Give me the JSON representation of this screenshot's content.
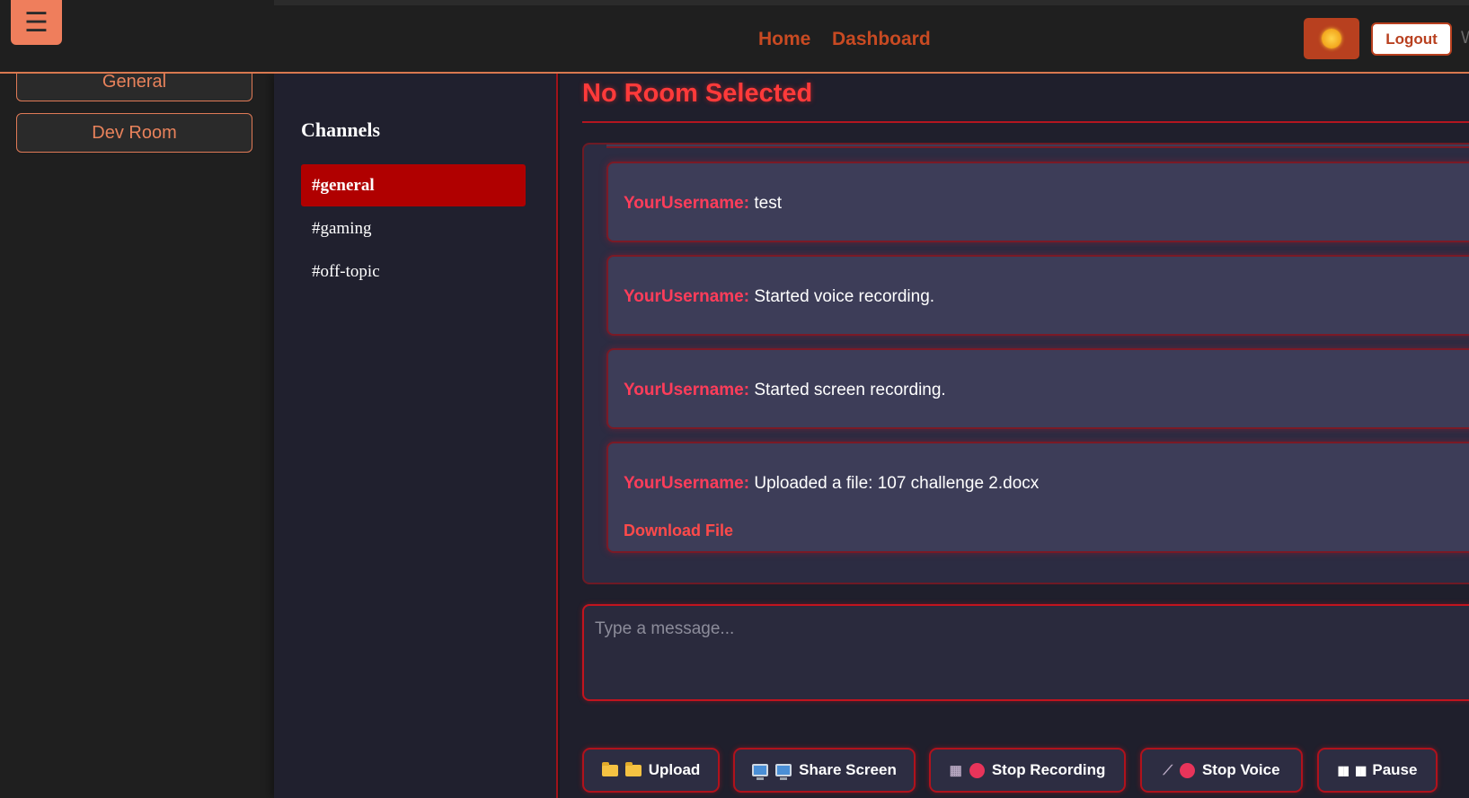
{
  "topnav": {
    "menu_glyph": "☰",
    "links": [
      "Home",
      "Dashboard"
    ],
    "theme_icon": "sun-icon",
    "logout_label": "Logout",
    "cut_letter": "W"
  },
  "left_sidebar": {
    "rooms": [
      "General",
      "Dev Room"
    ]
  },
  "channels": {
    "title": "Channels",
    "items": [
      "#general",
      "#gaming",
      "#off-topic"
    ],
    "active": "#general"
  },
  "main": {
    "room_title": "No Room Selected",
    "messages": [
      {
        "user": "YourUsername:",
        "text": "test"
      },
      {
        "user": "YourUsername:",
        "text": "Started voice recording."
      },
      {
        "user": "YourUsername:",
        "text": "Started screen recording."
      },
      {
        "user": "YourUsername:",
        "text": "Uploaded a file: 107 challenge 2.docx",
        "link": "Download File"
      }
    ],
    "composer_placeholder": "Type a message...",
    "actions": [
      {
        "label": "Upload",
        "icons": [
          "folder-icon",
          "folder-icon"
        ]
      },
      {
        "label": "Share Screen",
        "icons": [
          "monitor-icon",
          "monitor-icon"
        ]
      },
      {
        "label": "Stop Recording",
        "icons": [
          "film-icon",
          "record-dot-icon"
        ]
      },
      {
        "label": "Stop Voice",
        "icons": [
          "microphone-icon",
          "record-dot-icon"
        ]
      },
      {
        "label": "Pause",
        "icons": [
          "pause-icon",
          "pause-icon"
        ]
      }
    ]
  },
  "colors": {
    "accent_orange": "#e07a56",
    "accent_red": "#b00000",
    "title_red": "#ff3a3a",
    "username_red": "#ff3d5a"
  }
}
